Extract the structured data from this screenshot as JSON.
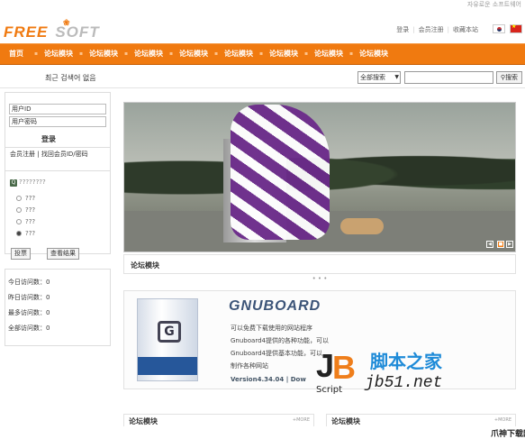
{
  "header": {
    "logo_free": "FREE",
    "logo_soft": "SOFT",
    "slogan": "자유로운 소프트웨어",
    "links": [
      "登录",
      "会员注册",
      "收藏本站"
    ]
  },
  "nav": {
    "items": [
      "首页",
      "论坛模块",
      "论坛模块",
      "论坛模块",
      "论坛模块",
      "论坛模块",
      "论坛模块",
      "论坛模块",
      "论坛模块"
    ]
  },
  "subbar": {
    "notice": "최근 검색어 없음",
    "search_select": "全部搜索",
    "search_button": "搜索"
  },
  "login": {
    "username": "用户ID",
    "password": "用户密码",
    "login_button": "登录",
    "register_link": "会员注册",
    "find_link": "找回会员ID/密码"
  },
  "poll": {
    "title": "????????",
    "options": [
      "???",
      "???",
      "???",
      "???"
    ],
    "vote_button": "投票",
    "result_button": "查看结果"
  },
  "stats": {
    "rows": [
      "今日访问数：0",
      "昨日访问数：0",
      "最多访问数：0",
      "全部访问数：0"
    ]
  },
  "main": {
    "board_title": "论坛模块",
    "dots": "• • •",
    "promo": {
      "product": "GNUBOARD",
      "line1": "可以免费下载使用的网站程序",
      "line2": "Gnuboard4提供的各种功能，可以",
      "line3": "Gnuboard4提供基本功能，可以",
      "line4": "制作各种网站",
      "version": "Version4.34.04 | Dow"
    },
    "bottom_left_title": "论坛模块",
    "bottom_right_title": "论坛模块",
    "more": "+MORE"
  },
  "watermark": {
    "script": "Script",
    "cn": "脚本之家",
    "url": "jb51.net"
  },
  "corner": "爪神下载网"
}
